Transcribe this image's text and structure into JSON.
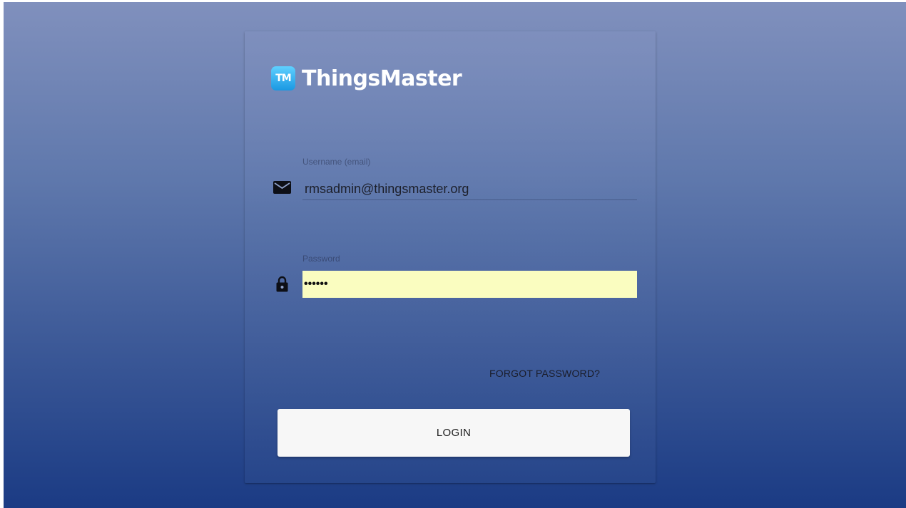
{
  "brand": {
    "badge_text": "TM",
    "name": "ThingsMaster",
    "badge_color": "#1a98e2"
  },
  "username": {
    "label": "Username (email)",
    "value": "rmsadmin@thingsmaster.org",
    "icon": "mail-icon"
  },
  "password": {
    "label": "Password",
    "value": "••••••",
    "icon": "lock-icon",
    "autofill_color": "#fafdc0"
  },
  "actions": {
    "forgot_label": "FORGOT PASSWORD?",
    "login_label": "LOGIN"
  },
  "theme": {
    "background_top": "#8090bd",
    "background_bottom": "#1b3b84"
  }
}
